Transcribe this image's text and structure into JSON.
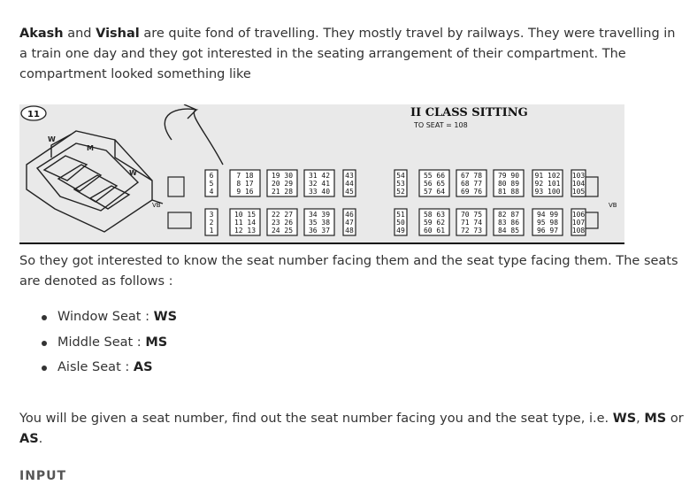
{
  "intro": {
    "name1": "Akash",
    "t1": " and ",
    "name2": "Vishal",
    "t2": " are quite fond of travelling. They mostly travel by railways. They were travelling in a train one day and they got interested in the seating arrangement of their compartment. The compartment looked something like"
  },
  "figure": {
    "badge": "11",
    "title": "II CLASS SITTING",
    "subtitle": "TO SEAT = 108",
    "vb_label": "VB",
    "top_row": [
      [
        "6",
        "5",
        "4"
      ],
      [
        "7 18",
        "8 17",
        "9 16"
      ],
      [
        "19 30",
        "20 29",
        "21 28"
      ],
      [
        "31 42",
        "32 41",
        "33 40"
      ],
      [
        "43",
        "44",
        "45"
      ],
      [
        "54",
        "53",
        "52"
      ],
      [
        "55 66",
        "56 65",
        "57 64"
      ],
      [
        "67 78",
        "68 77",
        "69 76"
      ],
      [
        "79 90",
        "80 89",
        "81 88"
      ],
      [
        "91 102",
        "92 101",
        "93 100"
      ],
      [
        "103",
        "104",
        "105"
      ]
    ],
    "bottom_row": [
      [
        "3",
        "2",
        "1"
      ],
      [
        "10 15",
        "11 14",
        "12 13"
      ],
      [
        "22 27",
        "23 26",
        "24 25"
      ],
      [
        "34 39",
        "35 38",
        "36 37"
      ],
      [
        "46",
        "47",
        "48"
      ],
      [
        "51",
        "50",
        "49"
      ],
      [
        "58 63",
        "59 62",
        "60 61"
      ],
      [
        "70 75",
        "71 74",
        "72 73"
      ],
      [
        "82 87",
        "83 86",
        "84 85"
      ],
      [
        "94 99",
        "95 98",
        "96 97"
      ],
      [
        "106",
        "107",
        "108"
      ]
    ]
  },
  "para2": "So they got interested to know the seat number facing them and the seat type facing them. The seats are denoted as follows :",
  "seat_types": [
    {
      "label": "Window Seat : ",
      "code": "WS"
    },
    {
      "label": "Middle Seat : ",
      "code": "MS"
    },
    {
      "label": "Aisle Seat : ",
      "code": "AS"
    }
  ],
  "para3": {
    "t1": "You will be given a seat number, find out the seat number facing you and the seat type, i.e. ",
    "c1": "WS",
    "t2": ", ",
    "c2": "MS",
    "t3": " or ",
    "c3": "AS",
    "t4": "."
  },
  "cut_heading": "INPUT"
}
